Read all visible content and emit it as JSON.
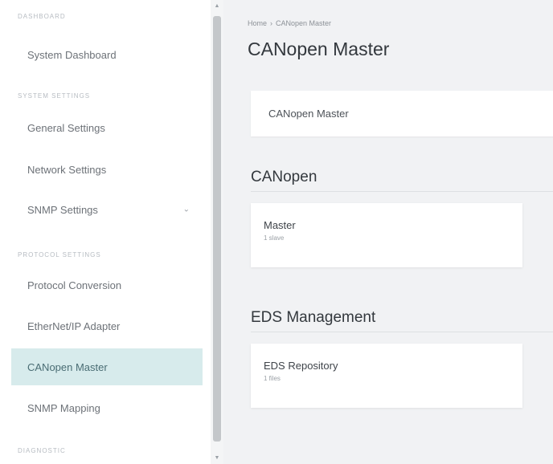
{
  "sidebar": {
    "sections": [
      {
        "heading": "DASHBOARD",
        "items": [
          {
            "label": "System Dashboard"
          }
        ]
      },
      {
        "heading": "SYSTEM SETTINGS",
        "items": [
          {
            "label": "General Settings"
          },
          {
            "label": "Network Settings"
          },
          {
            "label": "SNMP Settings"
          }
        ]
      },
      {
        "heading": "PROTOCOL SETTINGS",
        "items": [
          {
            "label": "Protocol Conversion"
          },
          {
            "label": "EtherNet/IP Adapter"
          },
          {
            "label": "CANopen Master",
            "active": true
          },
          {
            "label": "SNMP Mapping"
          }
        ]
      },
      {
        "heading": "DIAGNOSTIC",
        "items": []
      }
    ]
  },
  "breadcrumb": {
    "home": "Home",
    "separator": "›",
    "current": "CANopen Master"
  },
  "page": {
    "title": "CANopen Master"
  },
  "header_card": {
    "label": "CANopen Master"
  },
  "canopen": {
    "title": "CANopen",
    "tiles": [
      {
        "title": "Master",
        "subtitle": "1 slave"
      }
    ]
  },
  "eds": {
    "title": "EDS Management",
    "tiles": [
      {
        "title": "EDS Repository",
        "subtitle": "1 files"
      }
    ]
  },
  "colors": {
    "active_bg": "#d7ebec",
    "page_bg": "#f1f2f4"
  }
}
